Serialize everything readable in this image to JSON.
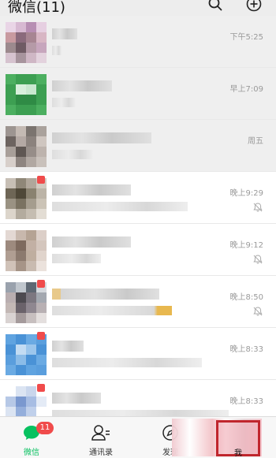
{
  "header": {
    "title": "微信(11)"
  },
  "chats": [
    {
      "time": "下午5:25",
      "muted": false,
      "pinned": true
    },
    {
      "time": "早上7:09",
      "muted": false,
      "pinned": true
    },
    {
      "time": "周五",
      "muted": false,
      "pinned": true
    },
    {
      "time": "晚上9:29",
      "muted": true,
      "pinned": false
    },
    {
      "time": "晚上9:12",
      "muted": true,
      "pinned": false
    },
    {
      "time": "晚上8:50",
      "muted": true,
      "pinned": false
    },
    {
      "time": "晚上8:33",
      "muted": false,
      "pinned": false
    },
    {
      "time": "晚上8:33",
      "muted": false,
      "pinned": false
    }
  ],
  "tabbar": {
    "tabs": [
      {
        "label": "微信",
        "badge": "11",
        "active": true,
        "icon": "chat-bubble-icon"
      },
      {
        "label": "通讯录",
        "active": false,
        "icon": "contacts-icon"
      },
      {
        "label": "发现",
        "active": false,
        "icon": "compass-icon"
      },
      {
        "label": "我",
        "active": false,
        "icon": "person-icon"
      }
    ]
  },
  "colors": {
    "accent": "#07c160",
    "badge": "#f04b4b",
    "highlight": "#c0262d"
  }
}
